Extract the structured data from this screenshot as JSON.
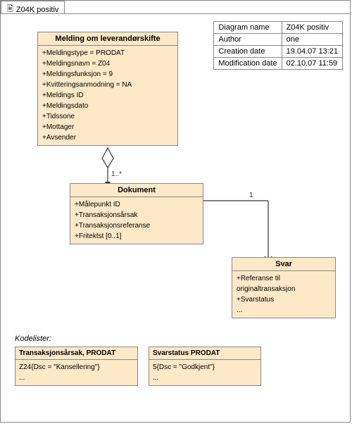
{
  "tab": {
    "icon": "diagram-icon",
    "label": "Z04K positiv"
  },
  "info": {
    "rows": [
      {
        "label": "Diagram name",
        "value": "Z04K positiv"
      },
      {
        "label": "Author",
        "value": "one"
      },
      {
        "label": "Creation date",
        "value": "19.04.07 13:21"
      },
      {
        "label": "Modification date",
        "value": "02.10.07 11:59"
      }
    ]
  },
  "classes": {
    "melding": {
      "title": "Melding om leverandørskifte",
      "attrs": [
        "+Meldingstype = PRODAT",
        "+Meldingsnavn = Z04",
        "+Meldingsfunksjon = 9",
        "+Kvitteringsanmodning = NA",
        "+Meldings ID",
        "+Meldingsdato",
        "+Tidssone",
        "+Mottager",
        "+Avsender"
      ]
    },
    "dokument": {
      "title": "Dokument",
      "attrs": [
        "+Målepunkt ID",
        "+Transaksjonsårsak",
        "+Transaksjonsreferanse",
        "+Fritektst [0..1]"
      ]
    },
    "svar": {
      "title": "Svar",
      "attrs": [
        "+Referanse til originaltransaksjon",
        "+Svarstatus",
        "..."
      ]
    }
  },
  "multiplicity": {
    "one_to_many": "1..*",
    "one": "1"
  },
  "codelists": {
    "label": "Kodelister:",
    "list1": {
      "title": "Transaksjonsårsak, PRODAT",
      "content": [
        "Z24{Dsc = \"Kansellering\"}",
        "..."
      ]
    },
    "list2": {
      "title": "Svarstatus PRODAT",
      "content": [
        "5{Dsc = \"Godkjent\"}",
        "..."
      ]
    }
  }
}
